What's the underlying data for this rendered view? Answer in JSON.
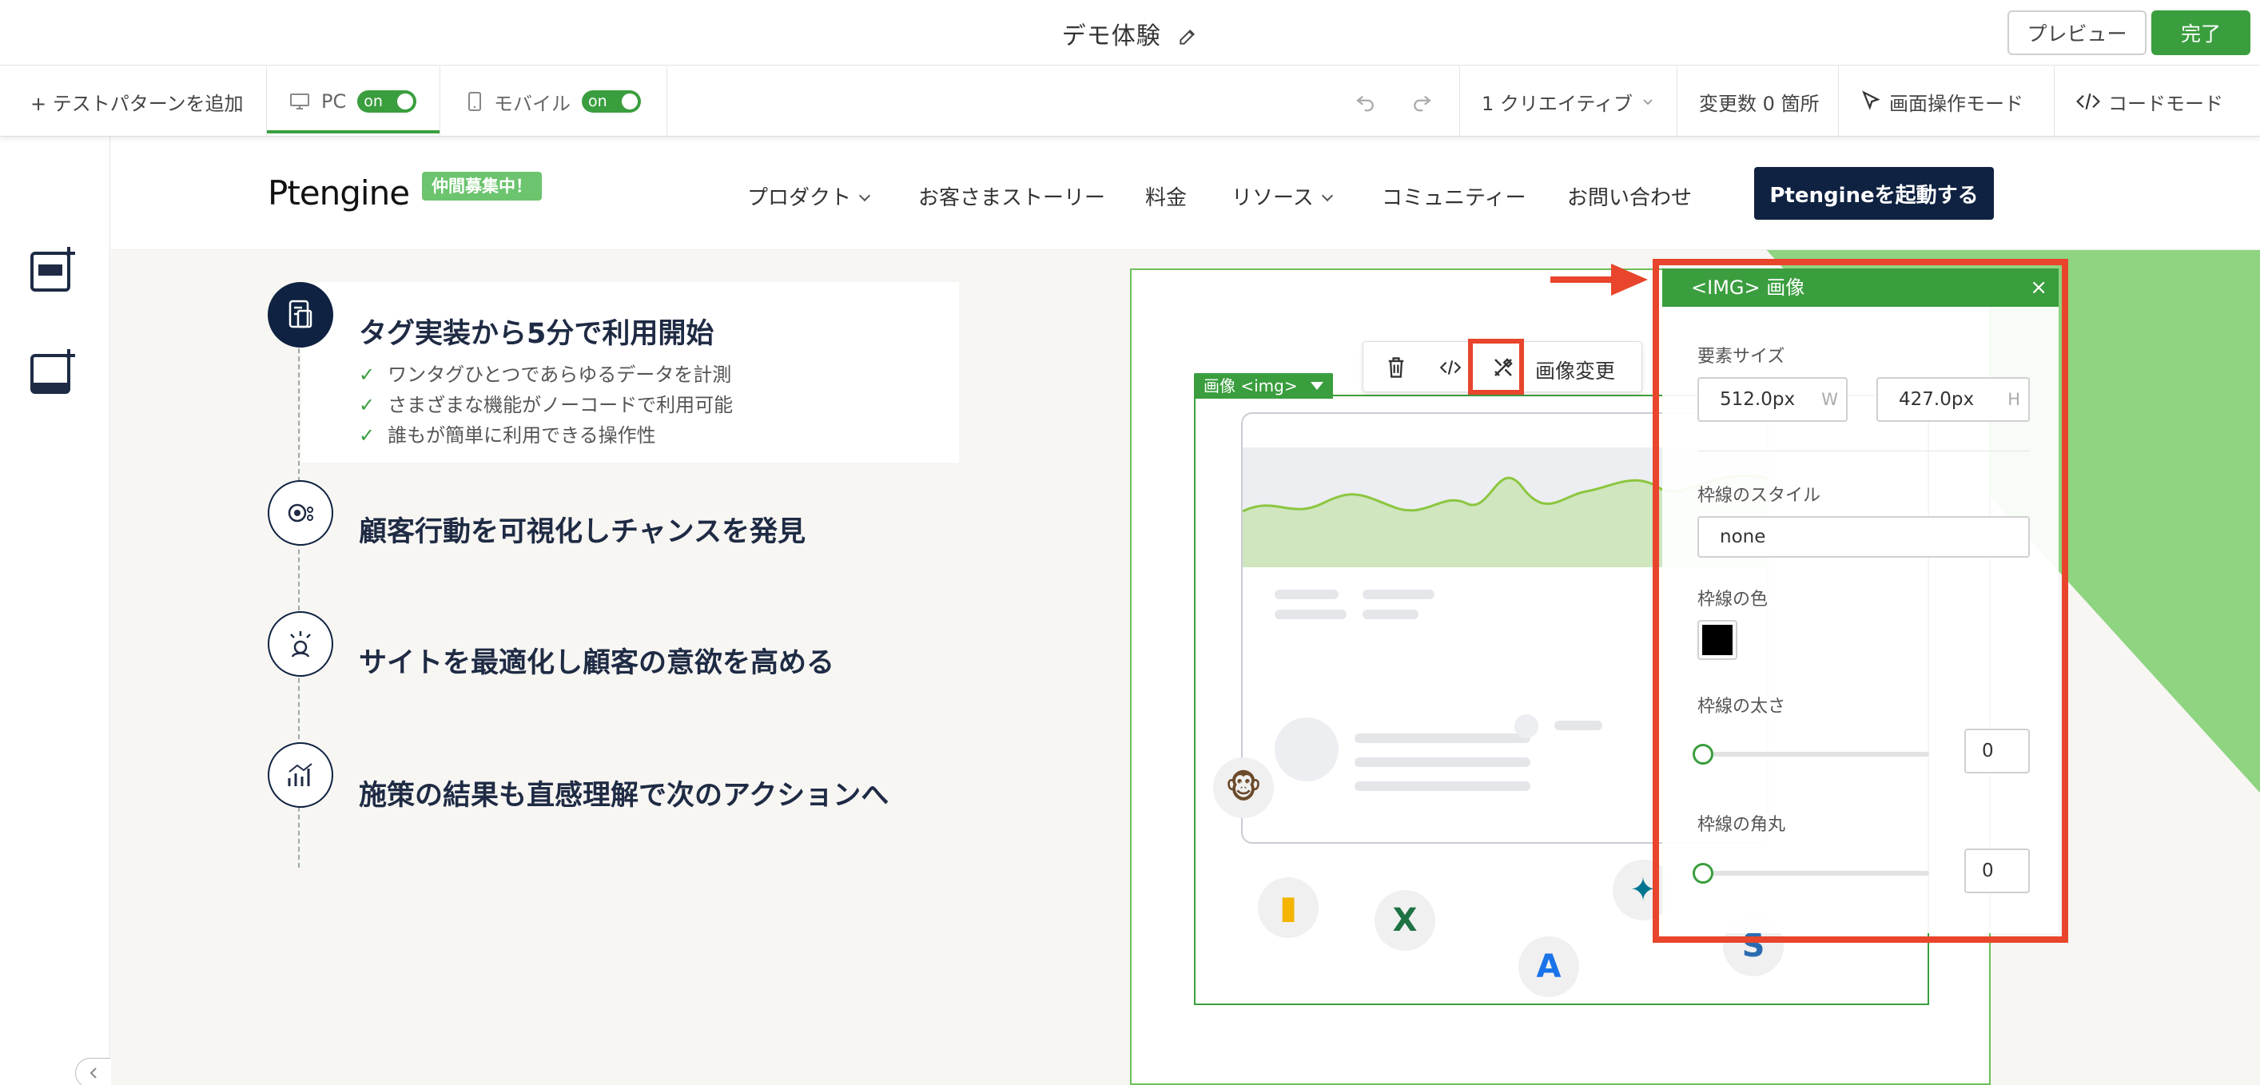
{
  "titlebar": {
    "title": "デモ体験",
    "preview_label": "プレビュー",
    "done_label": "完了"
  },
  "toolbar": {
    "add_pattern": "+ テストパターンを追加",
    "pc_label": "PC",
    "pc_toggle": "on",
    "mobile_label": "モバイル",
    "mobile_toggle": "on",
    "creative_label": "1 クリエイティブ",
    "changes_label": "変更数 0 箇所",
    "screen_mode_label": "画面操作モード",
    "code_mode_label": "コードモード"
  },
  "site": {
    "logo": "Ptengine",
    "hiring_badge": "仲間募集中！",
    "nav": [
      "プロダクト",
      "お客さまストーリー",
      "料金",
      "リソース",
      "コミュニティー",
      "お問い合わせ"
    ],
    "cta": "Ptengineを起動する",
    "features": [
      {
        "title": "タグ実装から5分で利用開始",
        "bullets": [
          "ワンタグひとつであらゆるデータを計測",
          "さまざまな機能がノーコードで利用可能",
          "誰もが簡単に利用できる操作性"
        ]
      },
      {
        "title": "顧客行動を可視化しチャンスを発見"
      },
      {
        "title": "サイトを最適化し顧客の意欲を高める"
      },
      {
        "title": "施策の結果も直感理解で次のアクションへ"
      }
    ]
  },
  "editor": {
    "img_tag": "画像 <img>",
    "change_image": "画像変更"
  },
  "panel": {
    "title": "<IMG> 画像",
    "size_label": "要素サイズ",
    "width_value": "512.0px",
    "width_unit": "W",
    "height_value": "427.0px",
    "height_unit": "H",
    "border_style_label": "枠線のスタイル",
    "border_style_value": "none",
    "border_color_label": "枠線の色",
    "border_color": "#000000",
    "border_width_label": "枠線の太さ",
    "border_width_value": "0",
    "border_radius_label": "枠線の角丸",
    "border_radius_value": "0"
  },
  "colors": {
    "accent_green": "#3a9e3e",
    "highlight_red": "#e8452c",
    "navy": "#0f2241"
  }
}
